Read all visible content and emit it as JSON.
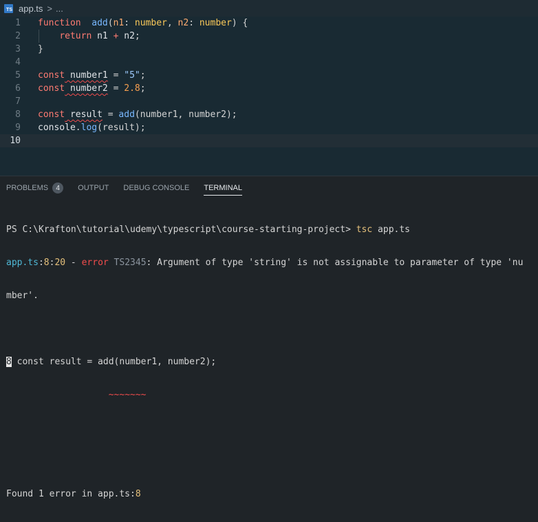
{
  "breadcrumb": {
    "file": "app.ts",
    "separator": ">",
    "more": "..."
  },
  "editor_lines": [
    {
      "n": "1",
      "tokens": [
        [
          "kw",
          "function"
        ],
        [
          "",
          "  "
        ],
        [
          "fn",
          "add"
        ],
        [
          "",
          "("
        ],
        [
          "param",
          "n1"
        ],
        [
          "",
          ": "
        ],
        [
          "type",
          "number"
        ],
        [
          "",
          ", "
        ],
        [
          "param",
          "n2"
        ],
        [
          "",
          ": "
        ],
        [
          "type",
          "number"
        ],
        [
          "",
          ") {"
        ]
      ]
    },
    {
      "n": "2",
      "tokens": [
        [
          "",
          "    "
        ],
        [
          "kw",
          "return"
        ],
        [
          "var",
          " n1 "
        ],
        [
          "kw",
          "+"
        ],
        [
          "var",
          " n2"
        ],
        [
          "",
          ";"
        ]
      ]
    },
    {
      "n": "3",
      "tokens": [
        [
          "",
          "}"
        ]
      ]
    },
    {
      "n": "4",
      "tokens": []
    },
    {
      "n": "5",
      "tokens": [
        [
          "kw",
          "const"
        ],
        [
          "",
          ""
        ],
        [
          "var sq",
          " number1"
        ],
        [
          "",
          " = "
        ],
        [
          "str",
          "\"5\""
        ],
        [
          "",
          ";"
        ]
      ]
    },
    {
      "n": "6",
      "tokens": [
        [
          "kw",
          "const"
        ],
        [
          "var sq",
          " number2"
        ],
        [
          "",
          " = "
        ],
        [
          "num",
          "2.8"
        ],
        [
          "",
          ";"
        ]
      ]
    },
    {
      "n": "7",
      "tokens": []
    },
    {
      "n": "8",
      "tokens": [
        [
          "kw",
          "const"
        ],
        [
          "var sq",
          " result"
        ],
        [
          "",
          " = "
        ],
        [
          "fn",
          "add"
        ],
        [
          "",
          "(number1, number2);"
        ]
      ]
    },
    {
      "n": "9",
      "tokens": [
        [
          "var",
          "console"
        ],
        [
          "",
          "."
        ],
        [
          "fn",
          "log"
        ],
        [
          "",
          "(result);"
        ]
      ]
    },
    {
      "n": "10",
      "tokens": []
    }
  ],
  "panel": {
    "tabs": [
      {
        "label": "PROBLEMS",
        "badge": "4"
      },
      {
        "label": "OUTPUT"
      },
      {
        "label": "DEBUG CONSOLE"
      },
      {
        "label": "TERMINAL",
        "active": true
      }
    ]
  },
  "terminal": {
    "prompt": "PS C:\\Krafton\\tutorial\\udemy\\typescript\\course-starting-project>",
    "command": "tsc",
    "command_arg": "app.ts",
    "err_file": "app.ts",
    "err_pos_sep1": ":",
    "err_line": "8",
    "err_pos_sep2": ":",
    "err_col": "20",
    "err_dash": " - ",
    "err_word": "error",
    "err_code": " TS2345",
    "err_msg": ": Argument of type 'string' is not assignable to parameter of type 'nu",
    "err_msg_wrap": "mber'.",
    "snippet_line_no": "8",
    "snippet_code": " const result = add(number1, number2);",
    "snippet_marker": "~~~~~~~",
    "found_text": "Found 1 error in app.ts",
    "found_sep": ":",
    "found_line": "8"
  }
}
